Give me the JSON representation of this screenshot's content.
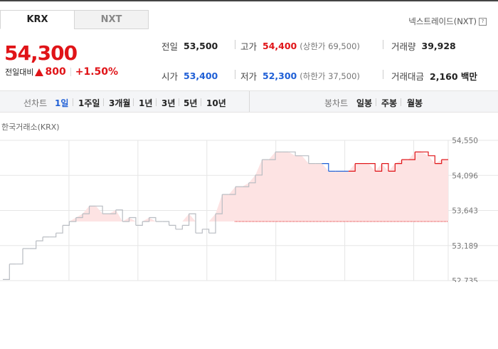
{
  "tabs": {
    "krx": "KRX",
    "nxt": "NXT"
  },
  "nxt_link": "넥스트레이드(NXT)",
  "nxt_help": "?",
  "price": "54,300",
  "change": {
    "label": "전일대비",
    "value": "800",
    "percent": "+1.50%"
  },
  "stats": {
    "prev_label": "전일",
    "prev_value": "53,500",
    "open_label": "시가",
    "open_value": "53,400",
    "high_label": "고가",
    "high_value": "54,400",
    "upper_limit": "(상한가 69,500)",
    "low_label": "저가",
    "low_value": "52,300",
    "lower_limit": "(하한가 37,500)",
    "volume_label": "거래량",
    "volume_value": "39,928",
    "amount_label": "거래대금",
    "amount_value": "2,160 백만"
  },
  "toolbar": {
    "line_label": "선차트",
    "periods": [
      "1일",
      "1주일",
      "3개월",
      "1년",
      "3년",
      "5년",
      "10년"
    ],
    "candle_label": "봉차트",
    "candles": [
      "일봉",
      "주봉",
      "월봉"
    ]
  },
  "exchange_label": "한국거래소(KRX)",
  "colors": {
    "up": "#e01418",
    "down": "#1f5fd6",
    "flat": "#b8bcc2",
    "fill": "#fde3e3"
  },
  "chart_data": {
    "type": "line",
    "baseline": 53500,
    "ylim": [
      52735,
      54550
    ],
    "y_ticks": [
      "54,550",
      "54,096",
      "53,643",
      "53,189",
      "52,735"
    ],
    "series": [
      {
        "values": [
          52750,
          52950,
          52950,
          53150,
          53150,
          53250,
          53300,
          53300,
          53350,
          53450,
          53500,
          53550,
          53600,
          53700,
          53700,
          53600,
          53600,
          53650,
          53500,
          53550,
          53450,
          53500,
          53550,
          53500,
          53500,
          53450,
          53400,
          53450,
          53600,
          53350,
          53400,
          53350,
          53600,
          53850,
          53850,
          53950,
          53950,
          54000,
          54100,
          54300,
          54300,
          54400,
          54400,
          54400,
          54350,
          54350,
          54250,
          54250,
          54250,
          54150,
          54150,
          54150,
          54150,
          54250,
          54250,
          54250,
          54150,
          54250,
          54150,
          54250,
          54300,
          54300,
          54400,
          54400,
          54350,
          54250,
          54300,
          54300
        ]
      }
    ]
  }
}
